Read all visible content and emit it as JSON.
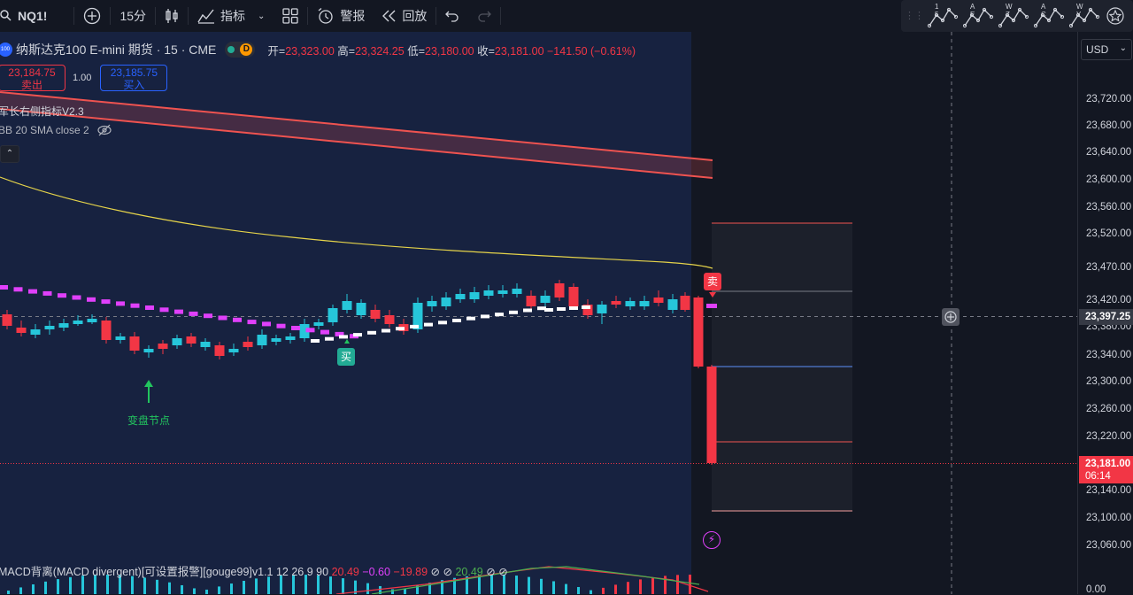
{
  "toolbar": {
    "symbol": "NQ1!",
    "interval": "15分",
    "indicators_label": "指标",
    "alert_label": "警报",
    "replay_label": "回放",
    "patterns": [
      "1 5",
      "A E",
      "W Z",
      "A C",
      "W Y"
    ]
  },
  "legend": {
    "logo_text": "100",
    "title": "纳斯达克100 E-mini 期货 · 15 · CME",
    "delayed_badge": "D",
    "ohlc": {
      "open_label": "开=",
      "open": "23,323.00",
      "high_label": "高=",
      "high": "23,324.25",
      "low_label": "低=",
      "low": "23,180.00",
      "close_label": "收=",
      "close": "23,181.00",
      "change": "−141.50 (−0.61%)"
    }
  },
  "trade": {
    "sell_price": "23,184.75",
    "sell_label": "卖出",
    "quantity": "1.00",
    "buy_price": "23,185.75",
    "buy_label": "买入"
  },
  "indicators": {
    "indicator1": "军长右侧指标V2.3",
    "indicator2": "BB 20 SMA close 2"
  },
  "markers": {
    "sell": "卖",
    "buy": "买",
    "note": "变盘节点"
  },
  "macd": {
    "name": "MACD背离(MACD divergent)[可设置报警][gouge99]v1.1 12 26 9 90",
    "v1": "20.49",
    "v2": "−0.60",
    "v3": "−19.89",
    "v4": "20.49"
  },
  "price_axis": {
    "currency": "USD",
    "ticks": [
      "23,720.00",
      "23,680.00",
      "23,640.00",
      "23,600.00",
      "23,560.00",
      "23,520.00",
      "23,470.00",
      "23,420.00",
      "23,380.00",
      "23,340.00",
      "23,300.00",
      "23,260.00",
      "23,220.00",
      "23,180.00",
      "23,140.00",
      "23,100.00",
      "23,060.00"
    ],
    "crosshair_price": "23,397.25",
    "last_price": "23,181.00",
    "countdown": "06:14",
    "macd_zero": "0.00"
  },
  "colors": {
    "up": "#22ab94",
    "down": "#f23645",
    "cyan": "#26c6da",
    "magenta": "#e040fb",
    "bb_band": "#ef5350",
    "sma": "#e6d44a",
    "session_bg": "#172240"
  }
}
